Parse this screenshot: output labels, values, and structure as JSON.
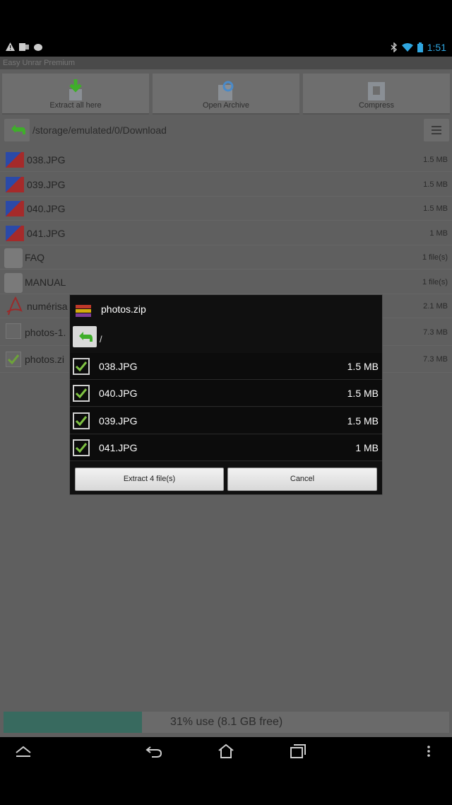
{
  "status": {
    "time": "1:51"
  },
  "app": {
    "title": "Easy Unrar Premium"
  },
  "toolbar": {
    "extract_label": "Extract all here",
    "open_label": "Open Archive",
    "compress_label": "Compress"
  },
  "path": "/storage/emulated/0/Download",
  "files": [
    {
      "name": "038.JPG",
      "size": "1.5 MB",
      "type": "jpg"
    },
    {
      "name": "039.JPG",
      "size": "1.5 MB",
      "type": "jpg"
    },
    {
      "name": "040.JPG",
      "size": "1.5 MB",
      "type": "jpg"
    },
    {
      "name": "041.JPG",
      "size": "1 MB",
      "type": "jpg"
    },
    {
      "name": "FAQ",
      "size": "1 file(s)",
      "type": "folder"
    },
    {
      "name": "MANUAL",
      "size": "1 file(s)",
      "type": "folder"
    },
    {
      "name": "numérisa",
      "size": "2.1 MB",
      "type": "pdf"
    },
    {
      "name": "photos-1.",
      "size": "7.3 MB",
      "type": "unchecked"
    },
    {
      "name": "photos.zi",
      "size": "7.3 MB",
      "type": "checked"
    }
  ],
  "storage": {
    "text": "31% use (8.1 GB free)",
    "percent": 31
  },
  "dialog": {
    "title": "photos.zip",
    "path": "/",
    "items": [
      {
        "name": "038.JPG",
        "size": "1.5 MB"
      },
      {
        "name": "040.JPG",
        "size": "1.5 MB"
      },
      {
        "name": "039.JPG",
        "size": "1.5 MB"
      },
      {
        "name": "041.JPG",
        "size": "1 MB"
      }
    ],
    "extract_label": "Extract 4 file(s)",
    "cancel_label": "Cancel"
  }
}
